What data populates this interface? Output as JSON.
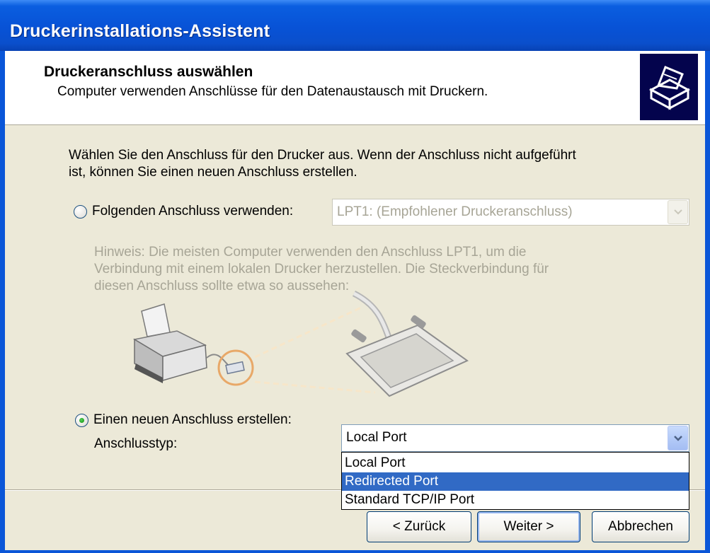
{
  "window": {
    "title": "Druckerinstallations-Assistent"
  },
  "header": {
    "title": "Druckeranschluss auswählen",
    "subtitle": "Computer verwenden Anschlüsse für den Datenaustausch mit Druckern.",
    "icon": "printer-icon"
  },
  "intro": {
    "line1": "Wählen Sie den Anschluss für den Drucker aus. Wenn der Anschluss nicht aufgeführt",
    "line2": "ist, können Sie einen neuen Anschluss erstellen."
  },
  "existing_port": {
    "label": "Folgenden Anschluss verwenden:",
    "selected": false,
    "value": "LPT1: (Empfohlener Druckeranschluss)",
    "hint_line1": "Hinweis: Die meisten Computer verwenden den Anschluss LPT1, um die",
    "hint_line2": "Verbindung mit einem lokalen Drucker herzustellen. Die Steckverbindung für",
    "hint_line3": "diesen Anschluss sollte etwa so aussehen:"
  },
  "new_port": {
    "label": "Einen neuen Anschluss erstellen:",
    "selected": true,
    "type_label": "Anschlusstyp:",
    "value": "Local Port",
    "options": [
      "Local Port",
      "Redirected Port",
      "Standard TCP/IP Port"
    ],
    "highlighted_option": "Redirected Port"
  },
  "buttons": {
    "back": "< Zurück",
    "next": "Weiter >",
    "cancel": "Abbrechen"
  },
  "colors": {
    "titlebar": "#0a56d8",
    "selection": "#316ac5",
    "disabled_text": "#a7a596",
    "dialog_bg": "#ece9d8"
  }
}
